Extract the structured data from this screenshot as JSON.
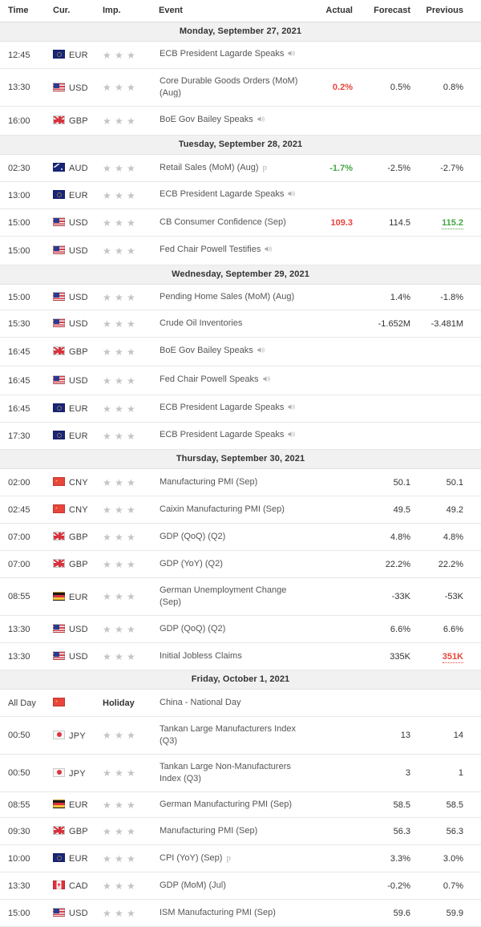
{
  "columns": {
    "time": "Time",
    "currency": "Cur.",
    "importance": "Imp.",
    "event": "Event",
    "actual": "Actual",
    "forecast": "Forecast",
    "previous": "Previous"
  },
  "labels": {
    "holiday": "Holiday",
    "all_day": "All Day",
    "preliminary_marker": "p",
    "speaker_icon": "speaker-icon",
    "star_icon": "star-icon"
  },
  "colors": {
    "worse": "#e8453c",
    "better": "#45a545",
    "neutral": "#333333",
    "day_header_bg": "#f1f1f1",
    "star_empty": "#c4c4c4"
  },
  "days": [
    {
      "date": "Monday, September 27, 2021",
      "rows": [
        {
          "time": "12:45",
          "currency": "EUR",
          "flag": "eu",
          "stars": 3,
          "event": "ECB President Lagarde Speaks",
          "speaker": true,
          "twoline": true,
          "actual": "",
          "forecast": "",
          "previous": ""
        },
        {
          "time": "13:30",
          "currency": "USD",
          "flag": "us",
          "stars": 3,
          "event": "Core Durable Goods Orders (MoM) (Aug)",
          "twoline": true,
          "actual": "0.2%",
          "actual_state": "worse",
          "forecast": "0.5%",
          "previous": "0.8%"
        },
        {
          "time": "16:00",
          "currency": "GBP",
          "flag": "gb",
          "stars": 3,
          "event": "BoE Gov Bailey Speaks",
          "speaker": true,
          "actual": "",
          "forecast": "",
          "previous": ""
        }
      ]
    },
    {
      "date": "Tuesday, September 28, 2021",
      "rows": [
        {
          "time": "02:30",
          "currency": "AUD",
          "flag": "au",
          "stars": 3,
          "event": "Retail Sales (MoM) (Aug)",
          "preliminary": true,
          "actual": "-1.7%",
          "actual_state": "better",
          "forecast": "-2.5%",
          "previous": "-2.7%"
        },
        {
          "time": "13:00",
          "currency": "EUR",
          "flag": "eu",
          "stars": 3,
          "event": "ECB President Lagarde Speaks",
          "speaker": true,
          "twoline": true,
          "actual": "",
          "forecast": "",
          "previous": ""
        },
        {
          "time": "15:00",
          "currency": "USD",
          "flag": "us",
          "stars": 3,
          "event": "CB Consumer Confidence (Sep)",
          "actual": "109.3",
          "actual_state": "worse",
          "forecast": "114.5",
          "previous": "115.2",
          "previous_state": "better",
          "previous_revised": true
        },
        {
          "time": "15:00",
          "currency": "USD",
          "flag": "us",
          "stars": 3,
          "event": "Fed Chair Powell Testifies",
          "speaker": true,
          "actual": "",
          "forecast": "",
          "previous": ""
        }
      ]
    },
    {
      "date": "Wednesday, September 29, 2021",
      "rows": [
        {
          "time": "15:00",
          "currency": "USD",
          "flag": "us",
          "stars": 3,
          "event": "Pending Home Sales (MoM) (Aug)",
          "twoline": true,
          "actual": "",
          "forecast": "1.4%",
          "previous": "-1.8%"
        },
        {
          "time": "15:30",
          "currency": "USD",
          "flag": "us",
          "stars": 3,
          "event": "Crude Oil Inventories",
          "actual": "",
          "forecast": "-1.652M",
          "previous": "-3.481M"
        },
        {
          "time": "16:45",
          "currency": "GBP",
          "flag": "gb",
          "stars": 3,
          "event": "BoE Gov Bailey Speaks",
          "speaker": true,
          "actual": "",
          "forecast": "",
          "previous": ""
        },
        {
          "time": "16:45",
          "currency": "USD",
          "flag": "us",
          "stars": 3,
          "event": "Fed Chair Powell Speaks",
          "speaker": true,
          "actual": "",
          "forecast": "",
          "previous": ""
        },
        {
          "time": "16:45",
          "currency": "EUR",
          "flag": "eu",
          "stars": 3,
          "event": "ECB President Lagarde Speaks",
          "speaker": true,
          "twoline": true,
          "actual": "",
          "forecast": "",
          "previous": ""
        },
        {
          "time": "17:30",
          "currency": "EUR",
          "flag": "eu",
          "stars": 3,
          "event": "ECB President Lagarde Speaks",
          "speaker": true,
          "twoline": true,
          "actual": "",
          "forecast": "",
          "previous": ""
        }
      ]
    },
    {
      "date": "Thursday, September 30, 2021",
      "rows": [
        {
          "time": "02:00",
          "currency": "CNY",
          "flag": "cn",
          "stars": 3,
          "event": "Manufacturing PMI (Sep)",
          "actual": "",
          "forecast": "50.1",
          "previous": "50.1"
        },
        {
          "time": "02:45",
          "currency": "CNY",
          "flag": "cn",
          "stars": 3,
          "event": "Caixin Manufacturing PMI (Sep)",
          "actual": "",
          "forecast": "49.5",
          "previous": "49.2"
        },
        {
          "time": "07:00",
          "currency": "GBP",
          "flag": "gb",
          "stars": 3,
          "event": "GDP (QoQ) (Q2)",
          "actual": "",
          "forecast": "4.8%",
          "previous": "4.8%"
        },
        {
          "time": "07:00",
          "currency": "GBP",
          "flag": "gb",
          "stars": 3,
          "event": "GDP (YoY) (Q2)",
          "actual": "",
          "forecast": "22.2%",
          "previous": "22.2%"
        },
        {
          "time": "08:55",
          "currency": "EUR",
          "flag": "de",
          "stars": 3,
          "event": "German Unemployment Change (Sep)",
          "twoline": true,
          "actual": "",
          "forecast": "-33K",
          "previous": "-53K"
        },
        {
          "time": "13:30",
          "currency": "USD",
          "flag": "us",
          "stars": 3,
          "event": "GDP (QoQ) (Q2)",
          "actual": "",
          "forecast": "6.6%",
          "previous": "6.6%"
        },
        {
          "time": "13:30",
          "currency": "USD",
          "flag": "us",
          "stars": 3,
          "event": "Initial Jobless Claims",
          "actual": "",
          "forecast": "335K",
          "previous": "351K",
          "previous_state": "worse",
          "previous_revised": true
        }
      ]
    },
    {
      "date": "Friday, October 1, 2021",
      "rows": [
        {
          "time": "All Day",
          "currency": "",
          "flag": "cn",
          "holiday": true,
          "event": "China - National Day",
          "actual": "",
          "forecast": "",
          "previous": ""
        },
        {
          "time": "00:50",
          "currency": "JPY",
          "flag": "jp",
          "stars": 3,
          "event": "Tankan Large Manufacturers Index (Q3)",
          "twoline": true,
          "actual": "",
          "forecast": "13",
          "previous": "14"
        },
        {
          "time": "00:50",
          "currency": "JPY",
          "flag": "jp",
          "stars": 3,
          "event": "Tankan Large Non-Manufacturers Index (Q3)",
          "twoline": true,
          "actual": "",
          "forecast": "3",
          "previous": "1"
        },
        {
          "time": "08:55",
          "currency": "EUR",
          "flag": "de",
          "stars": 3,
          "event": "German Manufacturing PMI (Sep)",
          "twoline": true,
          "actual": "",
          "forecast": "58.5",
          "previous": "58.5"
        },
        {
          "time": "09:30",
          "currency": "GBP",
          "flag": "gb",
          "stars": 3,
          "event": "Manufacturing PMI (Sep)",
          "actual": "",
          "forecast": "56.3",
          "previous": "56.3"
        },
        {
          "time": "10:00",
          "currency": "EUR",
          "flag": "eu",
          "stars": 3,
          "event": "CPI (YoY) (Sep)",
          "preliminary": true,
          "actual": "",
          "forecast": "3.3%",
          "previous": "3.0%"
        },
        {
          "time": "13:30",
          "currency": "CAD",
          "flag": "ca",
          "stars": 3,
          "event": "GDP (MoM) (Jul)",
          "actual": "",
          "forecast": "-0.2%",
          "previous": "0.7%"
        },
        {
          "time": "15:00",
          "currency": "USD",
          "flag": "us",
          "stars": 3,
          "event": "ISM Manufacturing PMI (Sep)",
          "actual": "",
          "forecast": "59.6",
          "previous": "59.9"
        }
      ]
    }
  ]
}
